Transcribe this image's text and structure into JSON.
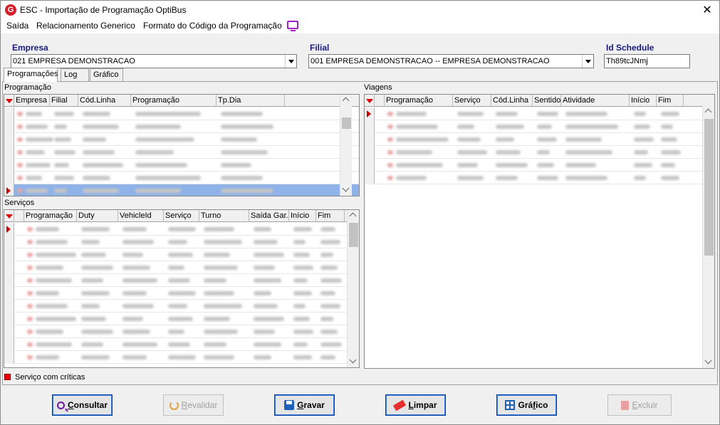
{
  "window": {
    "title": "ESC - Importação de Programação OptiBus",
    "logo": "G"
  },
  "menu": [
    "Saída",
    "Relacionamento Generico",
    "Formato do Código da Programação"
  ],
  "filters": {
    "empresa_label": "Empresa",
    "empresa_value": "021 EMPRESA DEMONSTRACAO",
    "filial_label": "Filial",
    "filial_value": "001 EMPRESA DEMONSTRACAO -- EMPRESA DEMONSTRACAO",
    "schedule_label": "Id Schedule",
    "schedule_value": "Th89tcJNmj"
  },
  "tabs": [
    "Programações",
    "Log",
    "Gráfico"
  ],
  "programacao": {
    "label": "Programação",
    "columns": [
      "Empresa",
      "Filial",
      "Cód.Linha",
      "Programação",
      "Tp.Dia"
    ],
    "row_count": 7,
    "selected_row": 7
  },
  "servicos": {
    "label": "Serviços",
    "columns": [
      "Programação",
      "Duty",
      "VehicleId",
      "Serviço",
      "Turno",
      "Saída Gar.",
      "Início",
      "Fim"
    ],
    "row_count": 11
  },
  "viagens": {
    "label": "Viagens",
    "columns": [
      "Programação",
      "Serviço",
      "Cód.Linha",
      "Sentido",
      "Atividade",
      "Início",
      "Fim"
    ],
    "row_count": 6
  },
  "legend": {
    "text": "Serviço com críticas",
    "color": "#e00000"
  },
  "buttons": {
    "consultar": {
      "pre": "",
      "ul": "C",
      "post": "onsultar"
    },
    "revalidar": {
      "pre": "",
      "ul": "R",
      "post": "evalidar"
    },
    "gravar": {
      "pre": "",
      "ul": "G",
      "post": "ravar"
    },
    "limpar": {
      "pre": "",
      "ul": "L",
      "post": "impar"
    },
    "grafico": {
      "pre": "Grá",
      "ul": "f",
      "post": "ico"
    },
    "excluir": {
      "pre": "",
      "ul": "E",
      "post": "xcluir"
    }
  }
}
